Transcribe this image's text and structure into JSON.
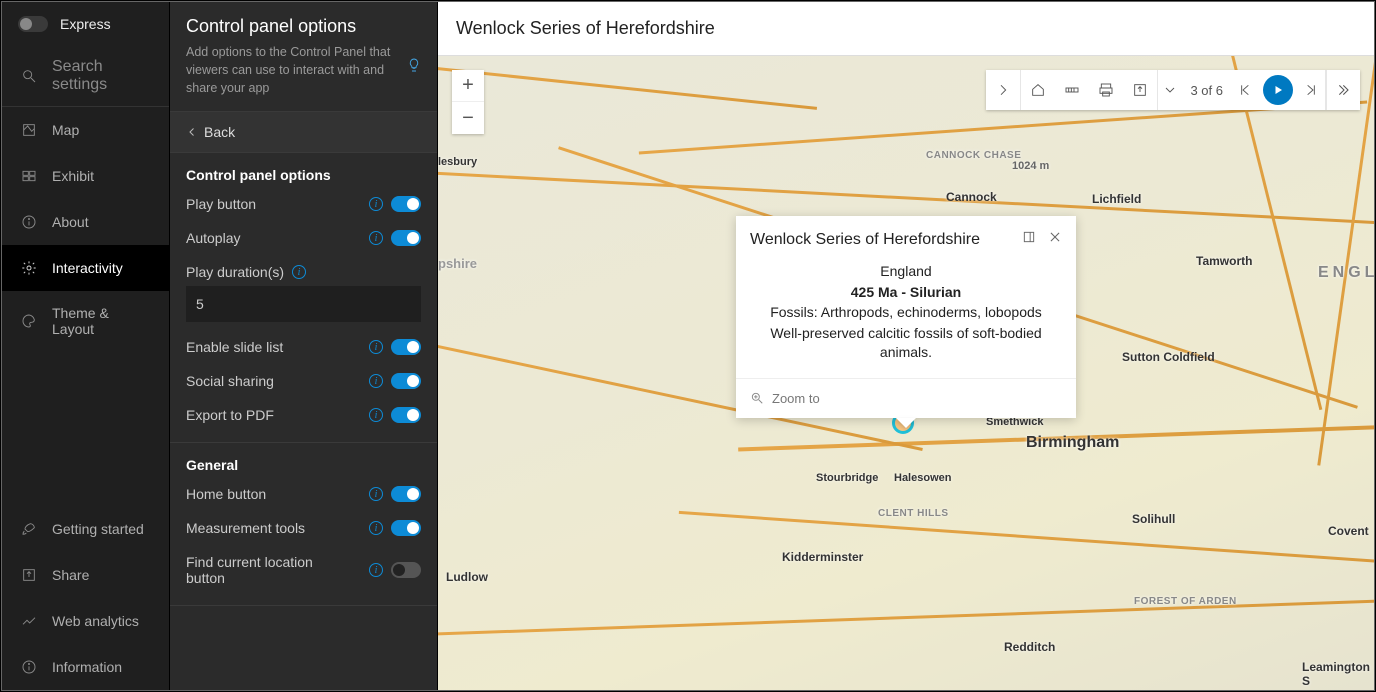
{
  "nav": {
    "express_label": "Express",
    "search_placeholder": "Search settings",
    "items": [
      {
        "label": "Map"
      },
      {
        "label": "Exhibit"
      },
      {
        "label": "About"
      },
      {
        "label": "Interactivity"
      },
      {
        "label": "Theme & Layout"
      }
    ],
    "bottom_items": [
      {
        "label": "Getting started"
      },
      {
        "label": "Share"
      },
      {
        "label": "Web analytics"
      },
      {
        "label": "Information"
      }
    ]
  },
  "panel": {
    "title": "Control panel options",
    "subtitle": "Add options to the Control Panel that viewers can use to interact with and share your app",
    "back_label": "Back",
    "section1_title": "Control panel options",
    "opts1": {
      "play_button": "Play button",
      "autoplay": "Autoplay",
      "play_duration_label": "Play duration(s)",
      "play_duration_value": "5",
      "enable_slide_list": "Enable slide list",
      "social_sharing": "Social sharing",
      "export_pdf": "Export to PDF"
    },
    "section2_title": "General",
    "opts2": {
      "home_button": "Home button",
      "measurement_tools": "Measurement tools",
      "find_location": "Find current location button"
    }
  },
  "map": {
    "title": "Wenlock Series of Herefordshire",
    "toolbar": {
      "page_text": "3 of 6"
    },
    "labels": {
      "cannock_chase": "CANNOCK CHASE",
      "cannock": "Cannock",
      "lichfield": "Lichfield",
      "tamworth": "Tamworth",
      "england": "ENGLA",
      "sutton": "Sutton Coldfield",
      "birmingham": "Birmingham",
      "smethwick": "Smethwick",
      "stourbridge": "Stourbridge",
      "halesowen": "Halesowen",
      "clent": "CLENT HILLS",
      "solihull": "Solihull",
      "kidderminster": "Kidderminster",
      "coventry": "Covent",
      "redditch": "Redditch",
      "arden": "FOREST OF ARDEN",
      "leamington": "Leamington S",
      "ludlow": "Ludlow",
      "shire": "pshire",
      "burg": "lesbury",
      "elevation": "1024 m"
    },
    "popup": {
      "title": "Wenlock Series of Herefordshire",
      "line1": "England",
      "line2": "425 Ma - Silurian",
      "line3": "Fossils: Arthropods, echinoderms, lobopods",
      "line4": "Well-preserved calcitic fossils of soft-bodied animals.",
      "zoom_label": "Zoom to"
    }
  }
}
